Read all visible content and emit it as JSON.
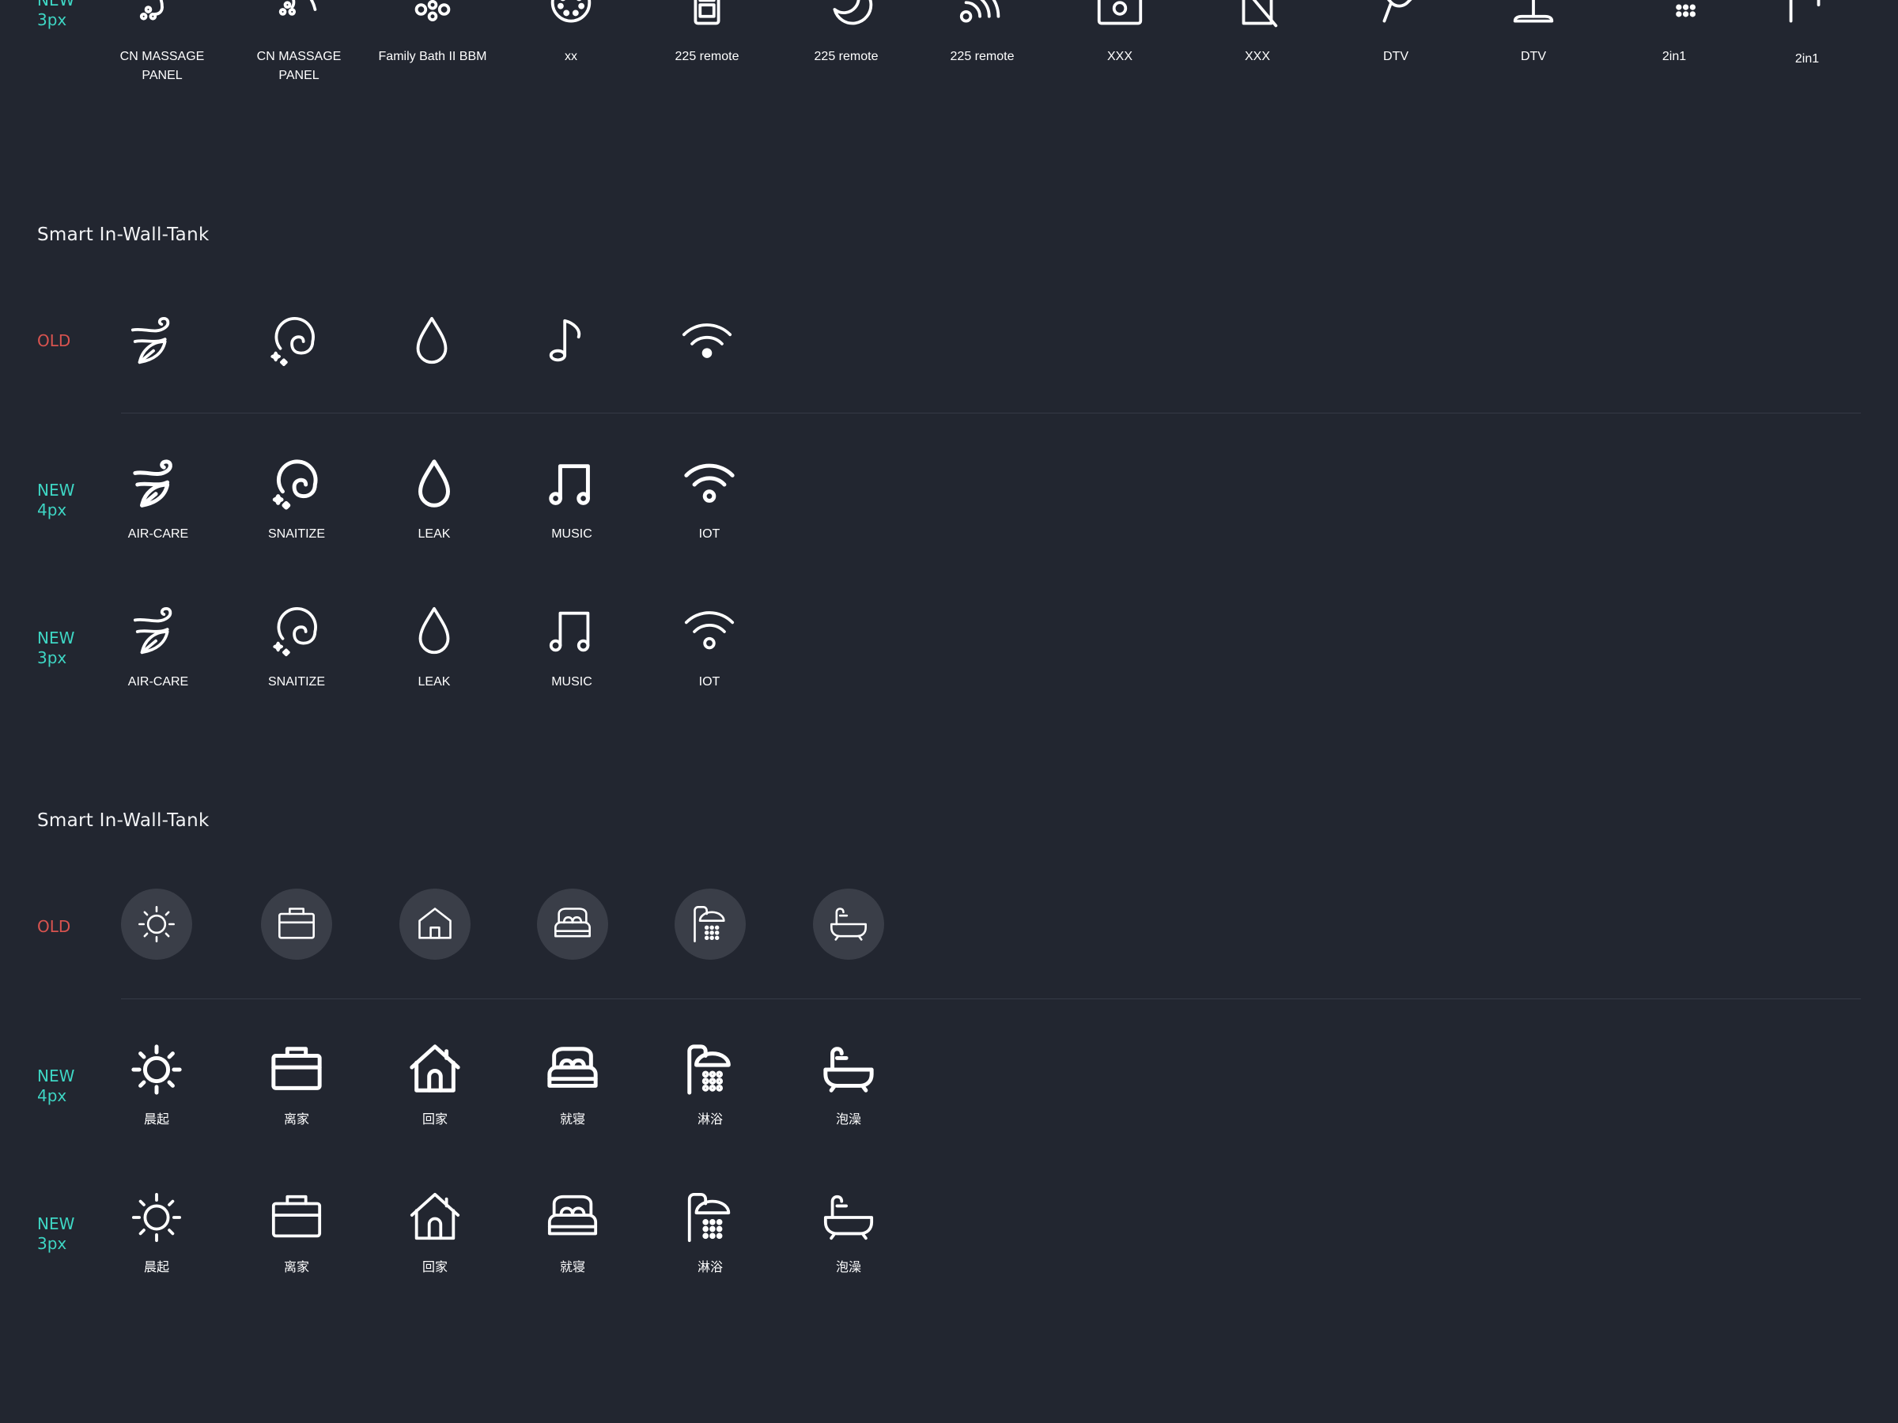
{
  "top_row": {
    "label_line1": "NEW",
    "label_line2": "3px",
    "items": [
      {
        "icon": "massage-panel-icon",
        "caption": "CN MASSAGE PANEL"
      },
      {
        "icon": "massage-panel-alt-icon",
        "caption": "CN MASSAGE PANEL"
      },
      {
        "icon": "bubbles-icon",
        "caption": "Family Bath II BBM"
      },
      {
        "icon": "dotted-circle-icon",
        "caption": "xx"
      },
      {
        "icon": "remote-icon",
        "caption": "225 remote"
      },
      {
        "icon": "moon-icon",
        "caption": "225 remote"
      },
      {
        "icon": "signal-icon",
        "caption": "225 remote"
      },
      {
        "icon": "radio-icon",
        "caption": "XXX"
      },
      {
        "icon": "phone-off-icon",
        "caption": "XXX"
      },
      {
        "icon": "faucet-icon",
        "caption": "DTV"
      },
      {
        "icon": "stand-icon",
        "caption": "DTV"
      },
      {
        "icon": "shower-head-icon",
        "caption": "2in1"
      },
      {
        "icon": "hand-shower-icon",
        "caption": "2in1"
      }
    ]
  },
  "section_a": {
    "title": "Smart In-Wall-Tank",
    "old_label": "OLD",
    "new4_line1": "NEW",
    "new4_line2": "4px",
    "new3_line1": "NEW",
    "new3_line2": "3px",
    "items": [
      {
        "icon": "air-care-icon",
        "caption": "AIR-CARE"
      },
      {
        "icon": "sanitize-icon",
        "caption": "SNAITIZE"
      },
      {
        "icon": "leak-drop-icon",
        "caption": "LEAK"
      },
      {
        "icon": "music-note-icon",
        "caption": "MUSIC"
      },
      {
        "icon": "wifi-iot-icon",
        "caption": "IOT"
      }
    ]
  },
  "section_b": {
    "title": "Smart In-Wall-Tank",
    "old_label": "OLD",
    "new4_line1": "NEW",
    "new4_line2": "4px",
    "new3_line1": "NEW",
    "new3_line2": "3px",
    "items": [
      {
        "icon": "sun-icon",
        "caption": "晨起"
      },
      {
        "icon": "briefcase-icon",
        "caption": "离家"
      },
      {
        "icon": "home-icon",
        "caption": "回家"
      },
      {
        "icon": "bed-icon",
        "caption": "就寝"
      },
      {
        "icon": "shower-icon",
        "caption": "淋浴"
      },
      {
        "icon": "bathtub-icon",
        "caption": "泡澡"
      }
    ]
  }
}
